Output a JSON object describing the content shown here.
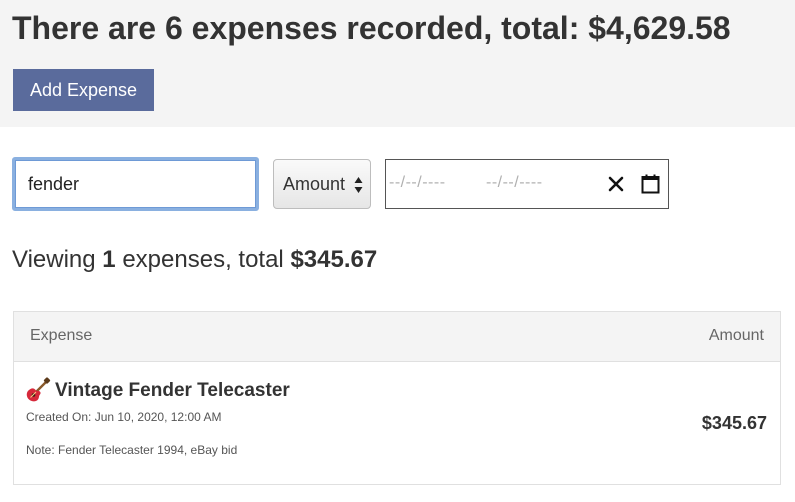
{
  "summary": {
    "prefix": "There are",
    "count": "6",
    "middle": "expenses recorded, total:",
    "total": "$4,629.58"
  },
  "actions": {
    "add_expense_label": "Add Expense"
  },
  "filters": {
    "search_value": "fender",
    "sort_by": "Amount",
    "date_start_placeholder": "--/--/----",
    "date_end_placeholder": "--/--/----"
  },
  "viewing": {
    "prefix": "Viewing",
    "count": "1",
    "middle": "expenses, total",
    "total": "$345.67"
  },
  "table": {
    "columns": {
      "expense": "Expense",
      "amount": "Amount"
    },
    "rows": [
      {
        "icon": "guitar-icon",
        "name": "Vintage Fender Telecaster",
        "created_on": "Created On: Jun 10, 2020, 12:00 AM",
        "note": "Note: Fender Telecaster 1994, eBay bid",
        "amount": "$345.67"
      }
    ]
  },
  "colors": {
    "primary_button": "#5a6b9c",
    "summary_background": "#f4f4f4",
    "focus_border": "#8ab0e0"
  }
}
